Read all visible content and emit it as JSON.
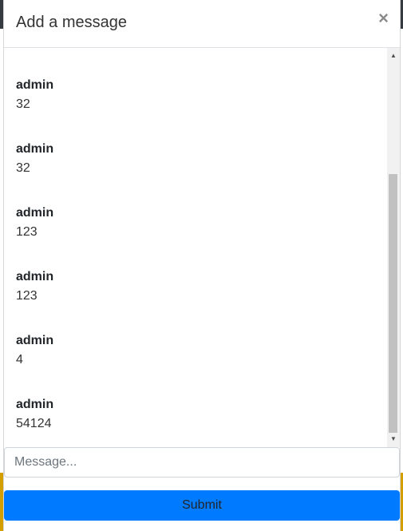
{
  "modal": {
    "title": "Add a message",
    "close_glyph": "×"
  },
  "messages": [
    {
      "author": "admin",
      "text": "32"
    },
    {
      "author": "admin",
      "text": "32"
    },
    {
      "author": "admin",
      "text": "123"
    },
    {
      "author": "admin",
      "text": "123"
    },
    {
      "author": "admin",
      "text": "4"
    },
    {
      "author": "admin",
      "text": "54124"
    }
  ],
  "composer": {
    "placeholder": "Message...",
    "value": "",
    "submit_label": "Submit"
  },
  "scrollbar": {
    "up_glyph": "▲",
    "down_glyph": "▼"
  },
  "colors": {
    "primary": "#007bff",
    "background_dark": "#343a40",
    "background_accent": "#d39e00"
  }
}
